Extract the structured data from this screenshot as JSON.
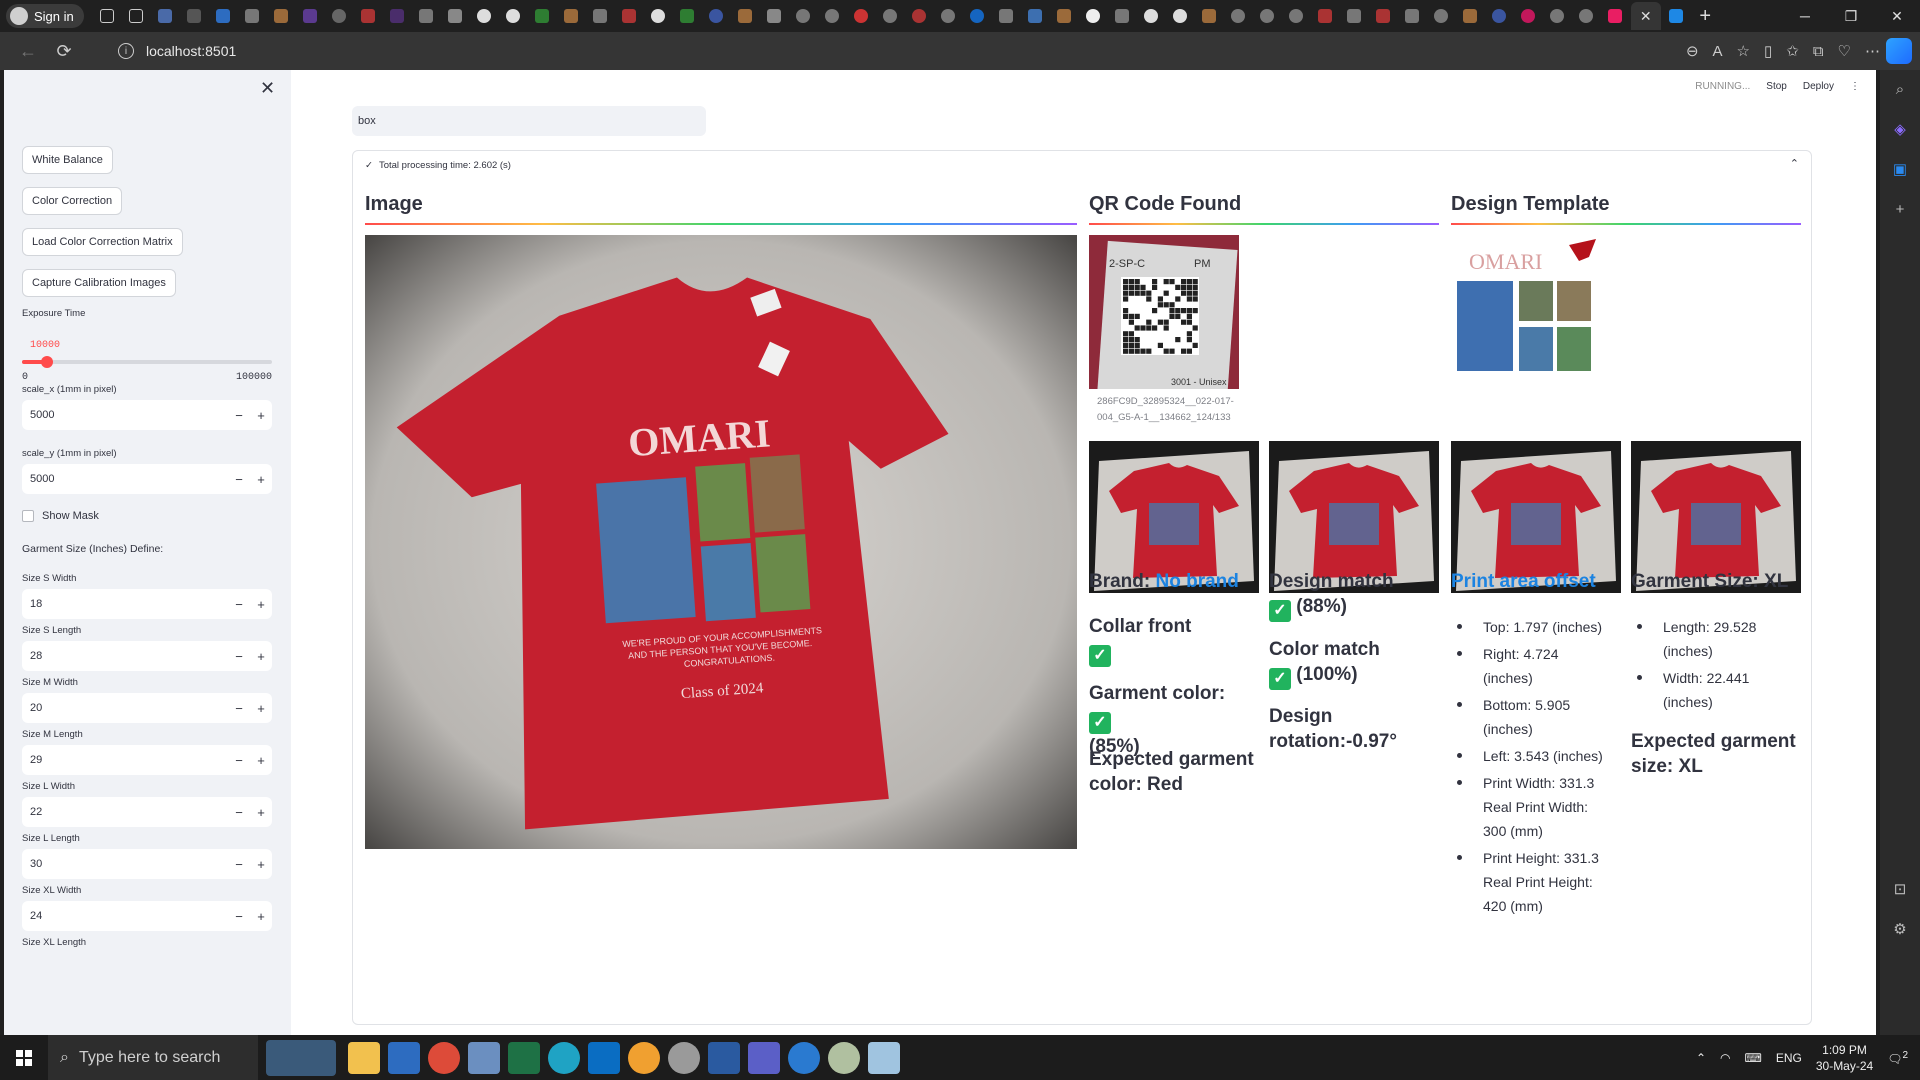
{
  "browser": {
    "signin_label": "Sign in",
    "url": "localhost:8501"
  },
  "taskbar": {
    "search_placeholder": "Type here to search",
    "lang": "ENG",
    "time": "1:09 PM",
    "date": "30-May-24",
    "notif": "2"
  },
  "sidebar": {
    "buttons": [
      "White Balance",
      "Color Correction",
      "Load Color Correction Matrix",
      "Capture Calibration Images"
    ],
    "exposure": {
      "label": "Exposure Time",
      "value": "10000",
      "min": "0",
      "max": "100000",
      "fraction": 0.1
    },
    "scale_x": {
      "label": "scale_x (1mm in pixel)",
      "value": "5000"
    },
    "scale_y": {
      "label": "scale_y (1mm in pixel)",
      "value": "5000"
    },
    "show_mask": "Show Mask",
    "garment_heading": "Garment Size (Inches) Define:",
    "sizes": [
      {
        "label": "Size S Width",
        "value": "18"
      },
      {
        "label": "Size S Length",
        "value": "28"
      },
      {
        "label": "Size M Width",
        "value": "20"
      },
      {
        "label": "Size M Length",
        "value": "29"
      },
      {
        "label": "Size L Width",
        "value": "22"
      },
      {
        "label": "Size L Length",
        "value": "30"
      },
      {
        "label": "Size XL Width",
        "value": "24"
      },
      {
        "label": "Size XL Length",
        "value": ""
      }
    ]
  },
  "topbar": {
    "running": "RUNNING...",
    "stop": "Stop",
    "deploy": "Deploy"
  },
  "main": {
    "input_value": "box",
    "expander_label": "Total processing time: 2.602 (s)",
    "headers": {
      "image": "Image",
      "qr": "QR Code Found",
      "design": "Design Template"
    },
    "qr_caption": "286FC9D_32895324__022-017-004_G5-A-1__134662_124/133",
    "shirt": {
      "name": "OMARI",
      "tagline1": "WE'RE PROUD OF YOUR ACCOMPLISHMENTS",
      "tagline2": "AND THE PERSON THAT YOU'VE BECOME.",
      "tagline3": "CONGRATULATIONS.",
      "class": "Class of 2024"
    },
    "qr_label1": "2-SP-C",
    "qr_label2": "PM",
    "qr_label3": "3001 - Unisex",
    "col1": {
      "brand_prefix": "Brand: ",
      "brand": "No brand",
      "collar": "Collar front",
      "garment_color": "Garment color:",
      "garment_pct": "(85%)",
      "expected_color": "Expected garment color: Red"
    },
    "col2": {
      "design_match": "Design match",
      "design_pct": "(88%)",
      "color_match": "Color match",
      "color_pct": "(100%)",
      "rotation": "Design rotation:-0.97°"
    },
    "col3": {
      "title": "Print area offset",
      "items": [
        "Top: 1.797 (inches)",
        "Right: 4.724 (inches)",
        "Bottom: 5.905 (inches)",
        "Left: 3.543 (inches)",
        "Print Width: 331.3 Real Print Width: 300 (mm)",
        "Print Height: 331.3 Real Print Height: 420 (mm)"
      ]
    },
    "col4": {
      "title": "Garment Size: XL",
      "items": [
        "Length: 29.528 (inches)",
        "Width: 22.441 (inches)"
      ],
      "expected": "Expected garment size: XL"
    }
  },
  "colors": {
    "accent": "#ff4b4b",
    "link": "#1c83e1",
    "check": "#21b35e",
    "shirt": "#c4202f"
  }
}
